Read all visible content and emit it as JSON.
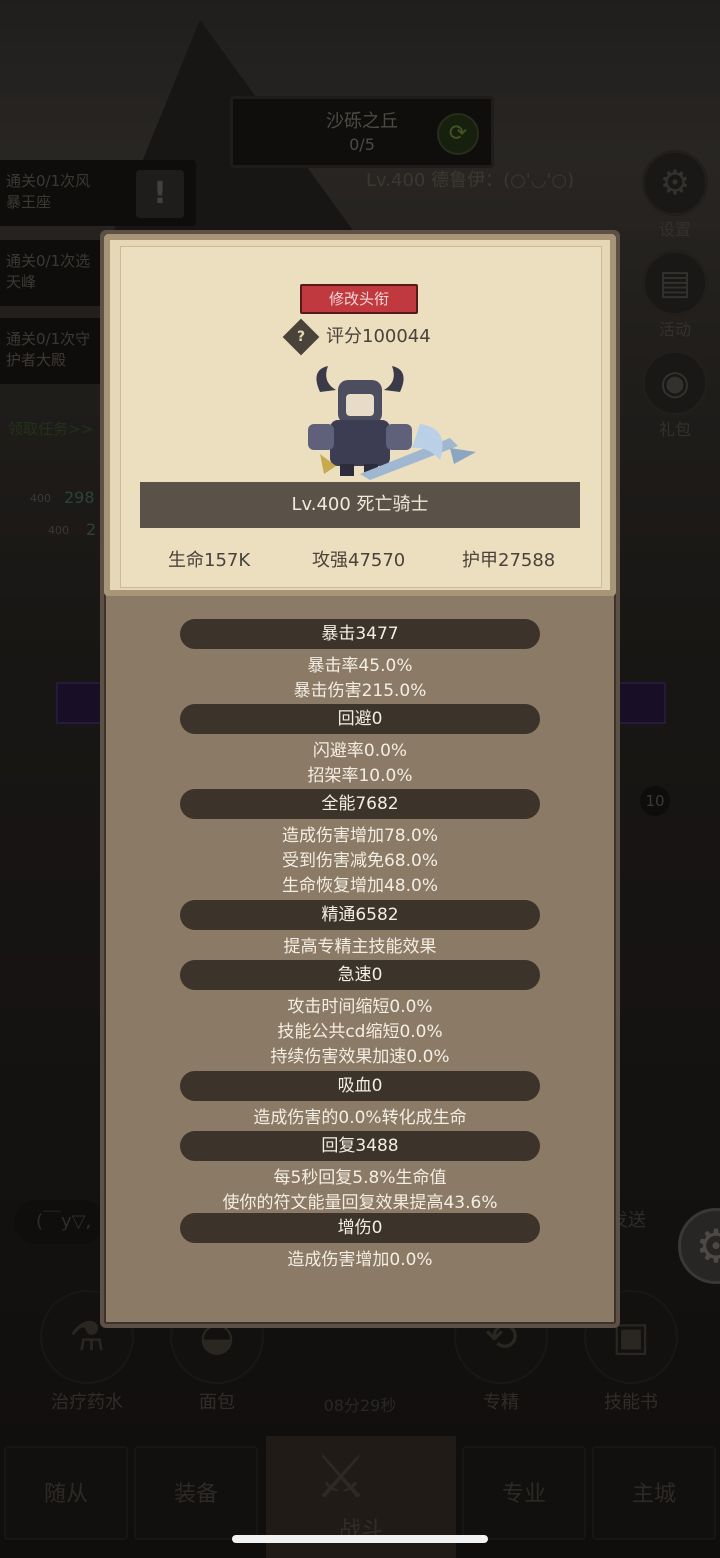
{
  "stage": {
    "name": "沙砾之丘",
    "progress": "0/5"
  },
  "player_line": "Lv.400 德鲁伊：(○'◡'○)",
  "quests": [
    {
      "line1": "通关0/1次风",
      "line2": "暴王座"
    },
    {
      "line1": "通关0/1次选",
      "line2": "天峰"
    },
    {
      "line1": "通关0/1次守",
      "line2": "护者大殿"
    }
  ],
  "quest_link": "领取任务>>",
  "side_menu": {
    "settings": "设置",
    "activity": "活动",
    "gift": "礼包"
  },
  "background_badges": {
    "lv1": "400",
    "val1": "298",
    "lv2": "400",
    "val2": "2"
  },
  "chat_text": "(￣y▽,",
  "chat_send": "发送",
  "slot_badge": "10",
  "bottom_actions": {
    "potion": "治疗药水",
    "bread": "面包",
    "specialize": "专精",
    "skillbook": "技能书"
  },
  "timer": "08分29秒",
  "tabs": {
    "follower": "随从",
    "equip": "装备",
    "battle": "战斗",
    "profession": "专业",
    "city": "主城"
  },
  "popup": {
    "edit_title": "修改头衔",
    "score": "评分100044",
    "hero_name": "Lv.400 死亡骑士",
    "hp": "生命157K",
    "attack": "攻强47570",
    "armor": "护甲27588",
    "stats": [
      {
        "header": "暴击3477",
        "lines": [
          "暴击率45.0%",
          "暴击伤害215.0%"
        ]
      },
      {
        "header": "回避0",
        "lines": [
          "闪避率0.0%",
          "招架率10.0%"
        ]
      },
      {
        "header": "全能7682",
        "lines": [
          "造成伤害增加78.0%",
          "受到伤害减免68.0%",
          "生命恢复增加48.0%"
        ]
      },
      {
        "header": "精通6582",
        "lines": [
          "提高专精主技能效果"
        ]
      },
      {
        "header": "急速0",
        "lines": [
          "攻击时间缩短0.0%",
          "技能公共cd缩短0.0%",
          "持续伤害效果加速0.0%"
        ]
      },
      {
        "header": "吸血0",
        "lines": [
          "造成伤害的0.0%转化成生命"
        ]
      },
      {
        "header": "回复3488",
        "lines": [
          "每5秒回复5.8%生命值",
          "使你的符文能量回复效果提高43.6%"
        ]
      },
      {
        "header": "增伤0",
        "lines": [
          "造成伤害增加0.0%"
        ]
      }
    ]
  },
  "colors": {
    "title_button": "#c0393e",
    "panel": "#8b7a65",
    "parchment": "#e6d7b6",
    "stat_bar": "#3c332a"
  }
}
